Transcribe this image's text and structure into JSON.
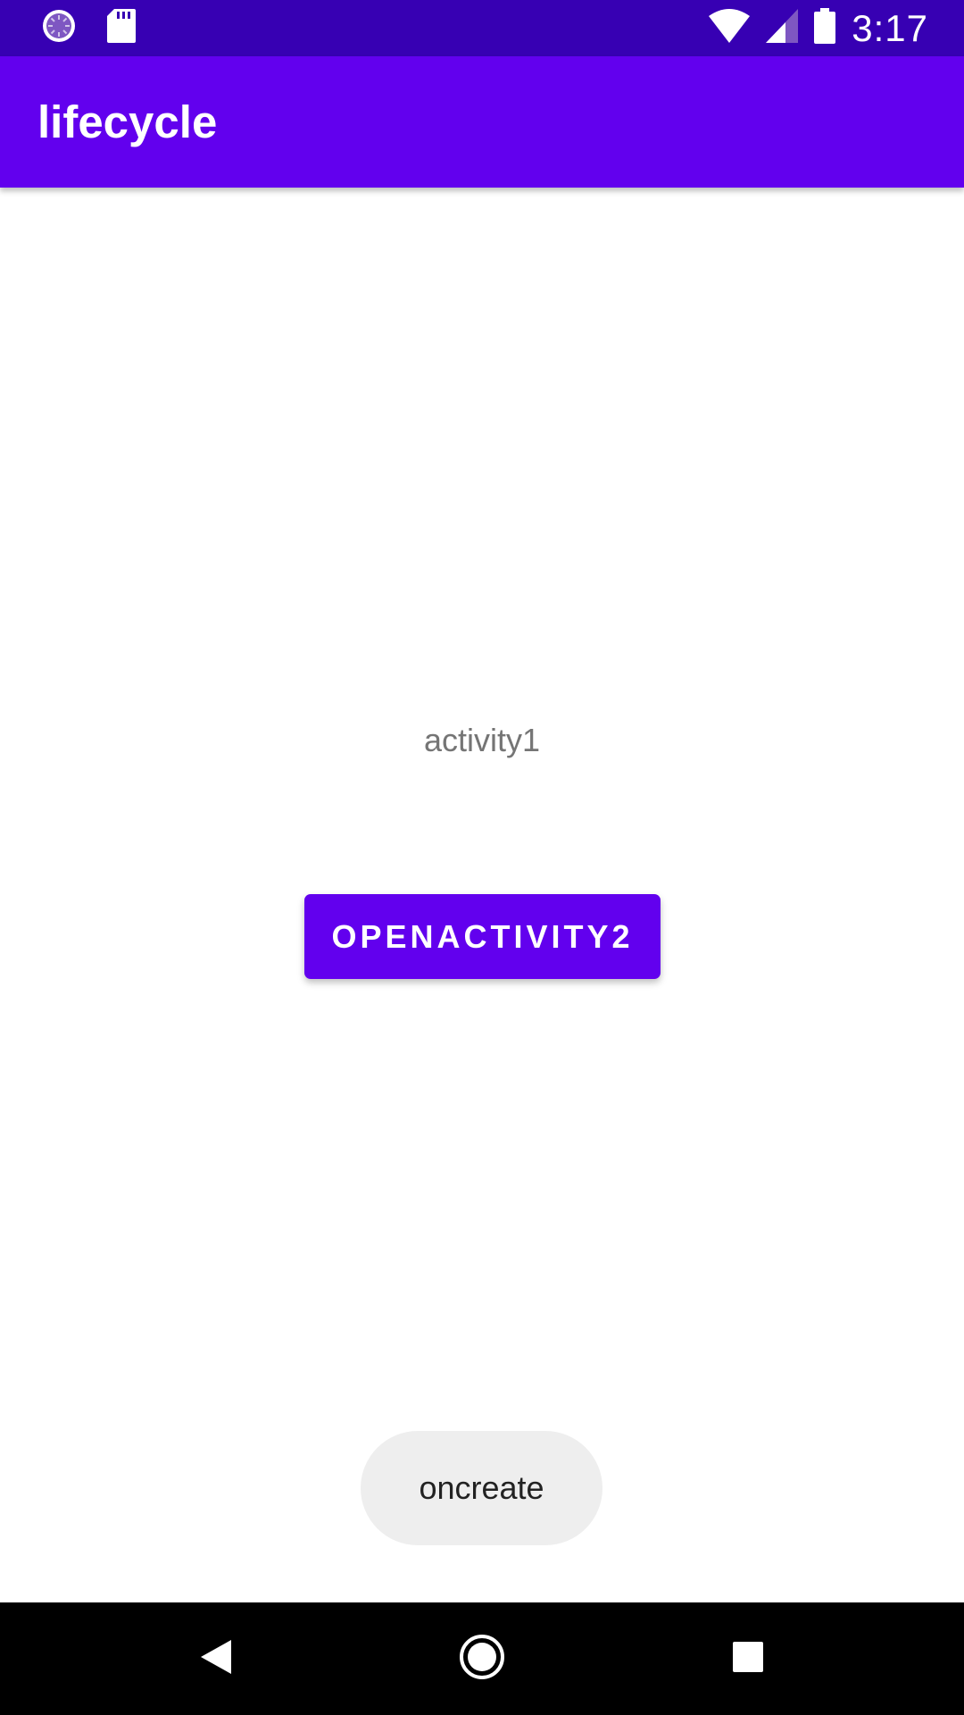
{
  "status_bar": {
    "time": "3:17",
    "left_icons": [
      "sync-icon",
      "sd-card-icon"
    ],
    "right_icons": [
      "wifi-icon",
      "cellular-signal-icon",
      "battery-icon"
    ]
  },
  "app_bar": {
    "title": "lifecycle"
  },
  "content": {
    "label": "activity1",
    "button_label": "OPENACTIVITY2"
  },
  "toast": {
    "message": "oncreate"
  },
  "nav_bar": {
    "buttons": [
      "back-icon",
      "home-icon",
      "recents-icon"
    ]
  },
  "colors": {
    "status_bar": "#3700B3",
    "primary": "#6200EE",
    "toast_bg": "#EEEEEE",
    "nav_bar": "#000000"
  }
}
